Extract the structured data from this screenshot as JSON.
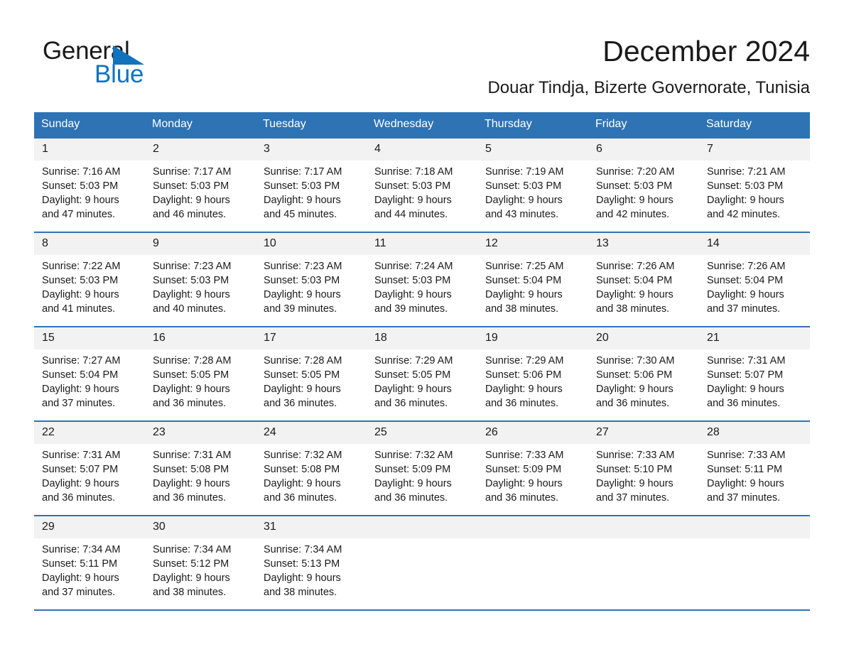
{
  "brand": {
    "name_part1": "General",
    "name_part2": "Blue",
    "accent_color": "#1272BC"
  },
  "header": {
    "title": "December 2024",
    "subtitle": "Douar Tindja, Bizerte Governorate, Tunisia"
  },
  "theme": {
    "header_blue": "#2E73B4",
    "date_band": "#F2F2F2"
  },
  "weekday_headers": [
    "Sunday",
    "Monday",
    "Tuesday",
    "Wednesday",
    "Thursday",
    "Friday",
    "Saturday"
  ],
  "weeks": [
    [
      {
        "day": "1",
        "sunrise": "Sunrise: 7:16 AM",
        "sunset": "Sunset: 5:03 PM",
        "daylight_line1": "Daylight: 9 hours",
        "daylight_line2": "and 47 minutes."
      },
      {
        "day": "2",
        "sunrise": "Sunrise: 7:17 AM",
        "sunset": "Sunset: 5:03 PM",
        "daylight_line1": "Daylight: 9 hours",
        "daylight_line2": "and 46 minutes."
      },
      {
        "day": "3",
        "sunrise": "Sunrise: 7:17 AM",
        "sunset": "Sunset: 5:03 PM",
        "daylight_line1": "Daylight: 9 hours",
        "daylight_line2": "and 45 minutes."
      },
      {
        "day": "4",
        "sunrise": "Sunrise: 7:18 AM",
        "sunset": "Sunset: 5:03 PM",
        "daylight_line1": "Daylight: 9 hours",
        "daylight_line2": "and 44 minutes."
      },
      {
        "day": "5",
        "sunrise": "Sunrise: 7:19 AM",
        "sunset": "Sunset: 5:03 PM",
        "daylight_line1": "Daylight: 9 hours",
        "daylight_line2": "and 43 minutes."
      },
      {
        "day": "6",
        "sunrise": "Sunrise: 7:20 AM",
        "sunset": "Sunset: 5:03 PM",
        "daylight_line1": "Daylight: 9 hours",
        "daylight_line2": "and 42 minutes."
      },
      {
        "day": "7",
        "sunrise": "Sunrise: 7:21 AM",
        "sunset": "Sunset: 5:03 PM",
        "daylight_line1": "Daylight: 9 hours",
        "daylight_line2": "and 42 minutes."
      }
    ],
    [
      {
        "day": "8",
        "sunrise": "Sunrise: 7:22 AM",
        "sunset": "Sunset: 5:03 PM",
        "daylight_line1": "Daylight: 9 hours",
        "daylight_line2": "and 41 minutes."
      },
      {
        "day": "9",
        "sunrise": "Sunrise: 7:23 AM",
        "sunset": "Sunset: 5:03 PM",
        "daylight_line1": "Daylight: 9 hours",
        "daylight_line2": "and 40 minutes."
      },
      {
        "day": "10",
        "sunrise": "Sunrise: 7:23 AM",
        "sunset": "Sunset: 5:03 PM",
        "daylight_line1": "Daylight: 9 hours",
        "daylight_line2": "and 39 minutes."
      },
      {
        "day": "11",
        "sunrise": "Sunrise: 7:24 AM",
        "sunset": "Sunset: 5:03 PM",
        "daylight_line1": "Daylight: 9 hours",
        "daylight_line2": "and 39 minutes."
      },
      {
        "day": "12",
        "sunrise": "Sunrise: 7:25 AM",
        "sunset": "Sunset: 5:04 PM",
        "daylight_line1": "Daylight: 9 hours",
        "daylight_line2": "and 38 minutes."
      },
      {
        "day": "13",
        "sunrise": "Sunrise: 7:26 AM",
        "sunset": "Sunset: 5:04 PM",
        "daylight_line1": "Daylight: 9 hours",
        "daylight_line2": "and 38 minutes."
      },
      {
        "day": "14",
        "sunrise": "Sunrise: 7:26 AM",
        "sunset": "Sunset: 5:04 PM",
        "daylight_line1": "Daylight: 9 hours",
        "daylight_line2": "and 37 minutes."
      }
    ],
    [
      {
        "day": "15",
        "sunrise": "Sunrise: 7:27 AM",
        "sunset": "Sunset: 5:04 PM",
        "daylight_line1": "Daylight: 9 hours",
        "daylight_line2": "and 37 minutes."
      },
      {
        "day": "16",
        "sunrise": "Sunrise: 7:28 AM",
        "sunset": "Sunset: 5:05 PM",
        "daylight_line1": "Daylight: 9 hours",
        "daylight_line2": "and 36 minutes."
      },
      {
        "day": "17",
        "sunrise": "Sunrise: 7:28 AM",
        "sunset": "Sunset: 5:05 PM",
        "daylight_line1": "Daylight: 9 hours",
        "daylight_line2": "and 36 minutes."
      },
      {
        "day": "18",
        "sunrise": "Sunrise: 7:29 AM",
        "sunset": "Sunset: 5:05 PM",
        "daylight_line1": "Daylight: 9 hours",
        "daylight_line2": "and 36 minutes."
      },
      {
        "day": "19",
        "sunrise": "Sunrise: 7:29 AM",
        "sunset": "Sunset: 5:06 PM",
        "daylight_line1": "Daylight: 9 hours",
        "daylight_line2": "and 36 minutes."
      },
      {
        "day": "20",
        "sunrise": "Sunrise: 7:30 AM",
        "sunset": "Sunset: 5:06 PM",
        "daylight_line1": "Daylight: 9 hours",
        "daylight_line2": "and 36 minutes."
      },
      {
        "day": "21",
        "sunrise": "Sunrise: 7:31 AM",
        "sunset": "Sunset: 5:07 PM",
        "daylight_line1": "Daylight: 9 hours",
        "daylight_line2": "and 36 minutes."
      }
    ],
    [
      {
        "day": "22",
        "sunrise": "Sunrise: 7:31 AM",
        "sunset": "Sunset: 5:07 PM",
        "daylight_line1": "Daylight: 9 hours",
        "daylight_line2": "and 36 minutes."
      },
      {
        "day": "23",
        "sunrise": "Sunrise: 7:31 AM",
        "sunset": "Sunset: 5:08 PM",
        "daylight_line1": "Daylight: 9 hours",
        "daylight_line2": "and 36 minutes."
      },
      {
        "day": "24",
        "sunrise": "Sunrise: 7:32 AM",
        "sunset": "Sunset: 5:08 PM",
        "daylight_line1": "Daylight: 9 hours",
        "daylight_line2": "and 36 minutes."
      },
      {
        "day": "25",
        "sunrise": "Sunrise: 7:32 AM",
        "sunset": "Sunset: 5:09 PM",
        "daylight_line1": "Daylight: 9 hours",
        "daylight_line2": "and 36 minutes."
      },
      {
        "day": "26",
        "sunrise": "Sunrise: 7:33 AM",
        "sunset": "Sunset: 5:09 PM",
        "daylight_line1": "Daylight: 9 hours",
        "daylight_line2": "and 36 minutes."
      },
      {
        "day": "27",
        "sunrise": "Sunrise: 7:33 AM",
        "sunset": "Sunset: 5:10 PM",
        "daylight_line1": "Daylight: 9 hours",
        "daylight_line2": "and 37 minutes."
      },
      {
        "day": "28",
        "sunrise": "Sunrise: 7:33 AM",
        "sunset": "Sunset: 5:11 PM",
        "daylight_line1": "Daylight: 9 hours",
        "daylight_line2": "and 37 minutes."
      }
    ],
    [
      {
        "day": "29",
        "sunrise": "Sunrise: 7:34 AM",
        "sunset": "Sunset: 5:11 PM",
        "daylight_line1": "Daylight: 9 hours",
        "daylight_line2": "and 37 minutes."
      },
      {
        "day": "30",
        "sunrise": "Sunrise: 7:34 AM",
        "sunset": "Sunset: 5:12 PM",
        "daylight_line1": "Daylight: 9 hours",
        "daylight_line2": "and 38 minutes."
      },
      {
        "day": "31",
        "sunrise": "Sunrise: 7:34 AM",
        "sunset": "Sunset: 5:13 PM",
        "daylight_line1": "Daylight: 9 hours",
        "daylight_line2": "and 38 minutes."
      },
      {
        "day": "",
        "sunrise": "",
        "sunset": "",
        "daylight_line1": "",
        "daylight_line2": ""
      },
      {
        "day": "",
        "sunrise": "",
        "sunset": "",
        "daylight_line1": "",
        "daylight_line2": ""
      },
      {
        "day": "",
        "sunrise": "",
        "sunset": "",
        "daylight_line1": "",
        "daylight_line2": ""
      },
      {
        "day": "",
        "sunrise": "",
        "sunset": "",
        "daylight_line1": "",
        "daylight_line2": ""
      }
    ]
  ]
}
